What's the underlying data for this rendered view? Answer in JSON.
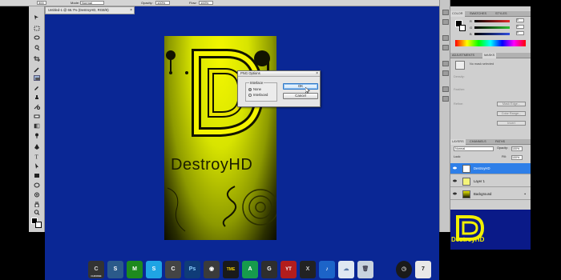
{
  "options_bar": {
    "mode_label": "Mode:",
    "mode_value": "Normal",
    "opacity_label": "Opacity:",
    "opacity_value": "100%",
    "flow_label": "Flow:",
    "flow_value": "100%",
    "size_value": "300"
  },
  "document": {
    "tab_title": "Untitled-1 @ 66.7% (DestroyHD, RGB/8)",
    "canvas_text": "DestroyHD"
  },
  "dialog": {
    "title": "PNG Options",
    "close": "×",
    "group_label": "Interlace",
    "option_none": "None",
    "option_interlaced": "Interlaced",
    "selected": "None",
    "ok": "OK",
    "cancel": "Cancel"
  },
  "color_panel": {
    "tabs": [
      "COLOR",
      "SWATCHES",
      "STYLES"
    ],
    "channels": [
      {
        "label": "R",
        "value": "0",
        "color": "#e32a2a"
      },
      {
        "label": "G",
        "value": "0",
        "color": "#2bc231"
      },
      {
        "label": "B",
        "value": "0",
        "color": "#2f4de0"
      }
    ]
  },
  "masks_panel": {
    "tabs": [
      "ADJUSTMENTS",
      "MASKS"
    ],
    "status": "No mask selected",
    "density_label": "Density:",
    "feather_label": "Feather:",
    "refine_label": "Refine:",
    "mask_edge": "Mask Edge...",
    "color_range": "Color Range...",
    "invert": "Invert"
  },
  "layers_panel": {
    "tabs": [
      "LAYERS",
      "CHANNELS",
      "PATHS"
    ],
    "blend_mode": "Normal",
    "opacity_label": "Opacity:",
    "opacity_value": "100%",
    "lock_label": "Lock:",
    "fill_label": "Fill:",
    "fill_value": "100%",
    "layers": [
      {
        "name": "DestroyHD",
        "selected": true
      },
      {
        "name": "Layer 1",
        "selected": false
      },
      {
        "name": "Background",
        "selected": false
      }
    ]
  },
  "logo_overlay": {
    "text": "DestroyHD"
  },
  "dock": {
    "apps": [
      {
        "label": "C",
        "sub": "CHROME",
        "color": "#333333"
      },
      {
        "label": "S",
        "color": "#2b5a8a"
      },
      {
        "label": "M",
        "color": "#1e8a1e"
      },
      {
        "label": "S",
        "color": "#1fa4e4"
      },
      {
        "label": "C",
        "color": "#444444"
      },
      {
        "label": "Ps",
        "color": "#0f3c78"
      },
      {
        "label": "◉",
        "color": "#3b3b3b"
      },
      {
        "label": "TME",
        "color": "#1a1a1a"
      },
      {
        "label": "A",
        "color": "#169c4c"
      },
      {
        "label": "G",
        "color": "#2e2e2e"
      },
      {
        "label": "YT",
        "color": "#b31d1d"
      },
      {
        "label": "X",
        "color": "#222222"
      },
      {
        "label": "♪",
        "color": "#1c64c8"
      },
      {
        "label": "☁",
        "color": "#dfe8f2"
      },
      {
        "label": "🗑",
        "color": "#c9d3de"
      },
      {
        "label": "◷",
        "color": "#1a1a1a"
      },
      {
        "label": "7",
        "color": "#e8e8e8"
      }
    ]
  }
}
